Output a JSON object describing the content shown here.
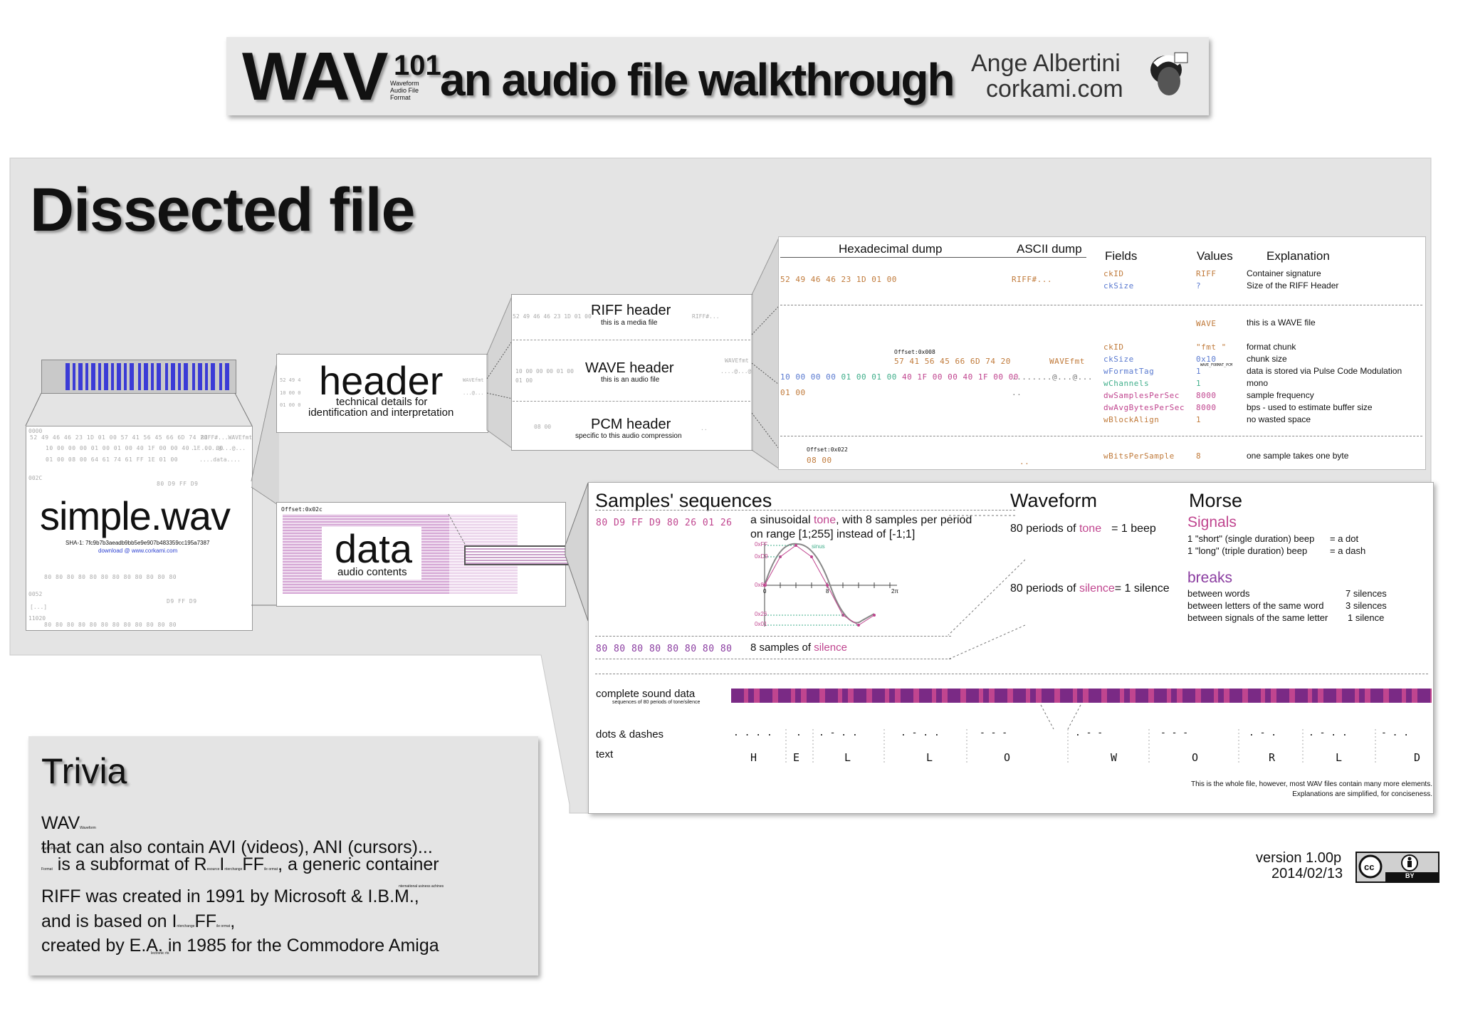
{
  "title": {
    "wav": "WAV",
    "sup": "101",
    "acronym": [
      "Waveform",
      "Audio File",
      "Format"
    ],
    "subtitle": "an audio file walkthrough",
    "author": "Ange Albertini",
    "site": "corkami.com"
  },
  "dissected": {
    "heading": "Dissected file",
    "file": {
      "name": "simple.wav",
      "sha": "SHA-1: 7fc9b7b3aeadb9bb5e9e907b483359cc195a7387",
      "download": "download @ www.corkami.com",
      "offsets": [
        "0000",
        "002C",
        "0052",
        "[...]",
        "11020"
      ],
      "hex_rows": [
        "52 49 46 46 23 1D 01 00 57 41 56 45 66 6D 74 20",
        "10 00 00 00 01 00 01 00 40 1F 00 00 40 1F 00 00",
        "01 00 08 00 64 61 74 61 FF 1E 01 00",
        "80 D9 FF D9",
        "80 80 80 80 80 80 80 80 80 80 80 80",
        "D9 FF D9",
        "80 80 80 80 80 80 80 80 80 80 80 80"
      ],
      "ascii_rows": [
        "RIFF#...WAVEfmt",
        "........@...@...",
        "....data....",
        "........"
      ]
    },
    "header_box": {
      "title": "header",
      "sub1": "technical details for",
      "sub2": "identification and interpretation",
      "hex": [
        "52 49 4",
        "10 00 0",
        "01 00 0"
      ],
      "ascii": [
        "WAVEfmt",
        "...@..."
      ]
    },
    "data_box": {
      "title": "data",
      "sub": "audio contents",
      "offset": "Offset:0x02c"
    },
    "sub_headers": [
      {
        "title": "RIFF header",
        "sub": "this is a media file",
        "hex": "52 49 46 46 23 1D 01 00",
        "ascii": "RIFF#..."
      },
      {
        "title": "WAVE header",
        "sub": "this is an audio file",
        "hex": "10 00 00 00 01 00",
        "hex2": "01 00",
        "ascii": "WAVEfmt",
        "ascii2": "....@...@"
      },
      {
        "title": "PCM header",
        "sub": "specific to this audio compression",
        "hex": "08 00",
        "ascii": ".."
      }
    ],
    "table": {
      "col_hex": "Hexadecimal dump",
      "col_ascii": "ASCII dump",
      "col_fields": "Fields",
      "col_values": "Values",
      "col_expl": "Explanation",
      "riff_hex": "52 49 46 46 23 1D 01 00",
      "riff_ascii": "RIFF#...",
      "wave_offset": "Offset:0x008",
      "wave_hex_top": "57 41 56 45 66 6D 74 20",
      "wave_ascii_top": "WAVEfmt",
      "wave_hex_main": "10 00 00 00 01 00 01 00 40 1F 00 00 40 1F 00 00",
      "wave_ascii_main": "........@...@...",
      "wave_hex_tail": "01 00",
      "wave_ascii_tail": "..",
      "pcm_offset": "Offset:0x022",
      "pcm_hex": "08 00",
      "pcm_ascii": "..",
      "rows": [
        {
          "field": "ckID",
          "value": "RIFF",
          "expl": "Container signature"
        },
        {
          "field": "ckSize",
          "value": "?",
          "expl": "Size of the RIFF Header"
        },
        {
          "field": "",
          "value": "WAVE",
          "expl": "this is a WAVE file"
        },
        {
          "field": "ckID",
          "value": "\"fmt \"",
          "expl": "format chunk"
        },
        {
          "field": "ckSize",
          "value": "0x10",
          "expl": "chunk size"
        },
        {
          "field": "wFormatTag",
          "value": "1",
          "expl": "data is stored via Pulse Code Modulation"
        },
        {
          "field": "wChannels",
          "value": "1",
          "expl": "mono"
        },
        {
          "field": "dwSamplesPerSec",
          "value": "8000",
          "expl": "sample frequency"
        },
        {
          "field": "dwAvgBytesPerSec",
          "value": "8000",
          "expl": "bps - used to estimate buffer size"
        },
        {
          "field": "wBlockAlign",
          "value": "1",
          "expl": "no wasted space"
        },
        {
          "field": "wBitsPerSample",
          "value": "8",
          "expl": "one sample takes one byte"
        }
      ],
      "wformat_note": "WAVE_FORMAT_PCM"
    }
  },
  "samples": {
    "heading": "Samples' sequences",
    "tone_hex": "80 D9 FF D9 80 26 01 26",
    "tone_text_a": "a sinusoidal ",
    "tone_word": "tone",
    "tone_text_b": ", with 8 samples per period",
    "tone_text_c": "on range [1;255] instead of [-1;1]",
    "silence_hex": "80 80 80 80 80 80 80 80",
    "silence_text_a": "8 samples of ",
    "silence_word": "silence",
    "graph_labels": [
      "0xFF",
      "0xD9",
      "0x80",
      "0x26",
      "0x01",
      "0",
      "8",
      "2π",
      "sinus"
    ]
  },
  "waveform": {
    "heading": "Waveform",
    "tone_a": "80 periods of ",
    "tone_word": "tone",
    "tone_b": "= 1 beep",
    "sil_a": "80 periods of ",
    "sil_word": "silence",
    "sil_b": "= 1 silence"
  },
  "morse": {
    "heading": "Morse",
    "signals": "Signals",
    "short": "1 \"short\" (single duration) beep",
    "short_eq": "= a dot",
    "long": "1 \"long\" (triple duration) beep",
    "long_eq": "= a dash",
    "breaks": "breaks",
    "b1": "between words",
    "b1v": "7 silences",
    "b2": "between letters of the same word",
    "b2v": "3 silences",
    "b3": "between signals of the same letter",
    "b3v": "1 silence"
  },
  "sound": {
    "complete": "complete sound data",
    "complete_sub": "sequences of 80 periods of tone/silence",
    "dots": "dots & dashes",
    "text": "text",
    "letters": [
      "H",
      "E",
      "L",
      "L",
      "O",
      "W",
      "O",
      "R",
      "L",
      "D"
    ],
    "morse_groups": [
      ". . . .",
      ".",
      ". - . .",
      ". - . .",
      "-   -   -",
      ". - -",
      "-   -   -",
      ". - .",
      ". - . .",
      "- . ."
    ]
  },
  "footer_note_1": "This is the whole file, however, most WAV files contain many more elements.",
  "footer_note_2": "Explanations are simplified, for conciseness.",
  "trivia": {
    "heading": "Trivia",
    "p1a": "WAV",
    "p1b": " is a subformat of R",
    "p1c": "I",
    "p1d": "FF",
    "p1e": ", a generic container",
    "p1f": "that can also contain AVI (videos), ANI (cursors)...",
    "resource": "esource",
    "interchange": "nterchange",
    "fileformat": "ile ormat",
    "p2a": "RIFF was created in 1991 by Microsoft & I.B.M.,",
    "p2b": "and is based on I",
    "p2c": "FF",
    "p2d": ",",
    "p2e": "created by E.A. in 1985 for the Commodore Amiga",
    "ibm_sup": "nternational usiness achines",
    "ea_sup": "lectronic rts"
  },
  "version": "version 1.00p",
  "date": "2014/02/13",
  "license": "BY"
}
